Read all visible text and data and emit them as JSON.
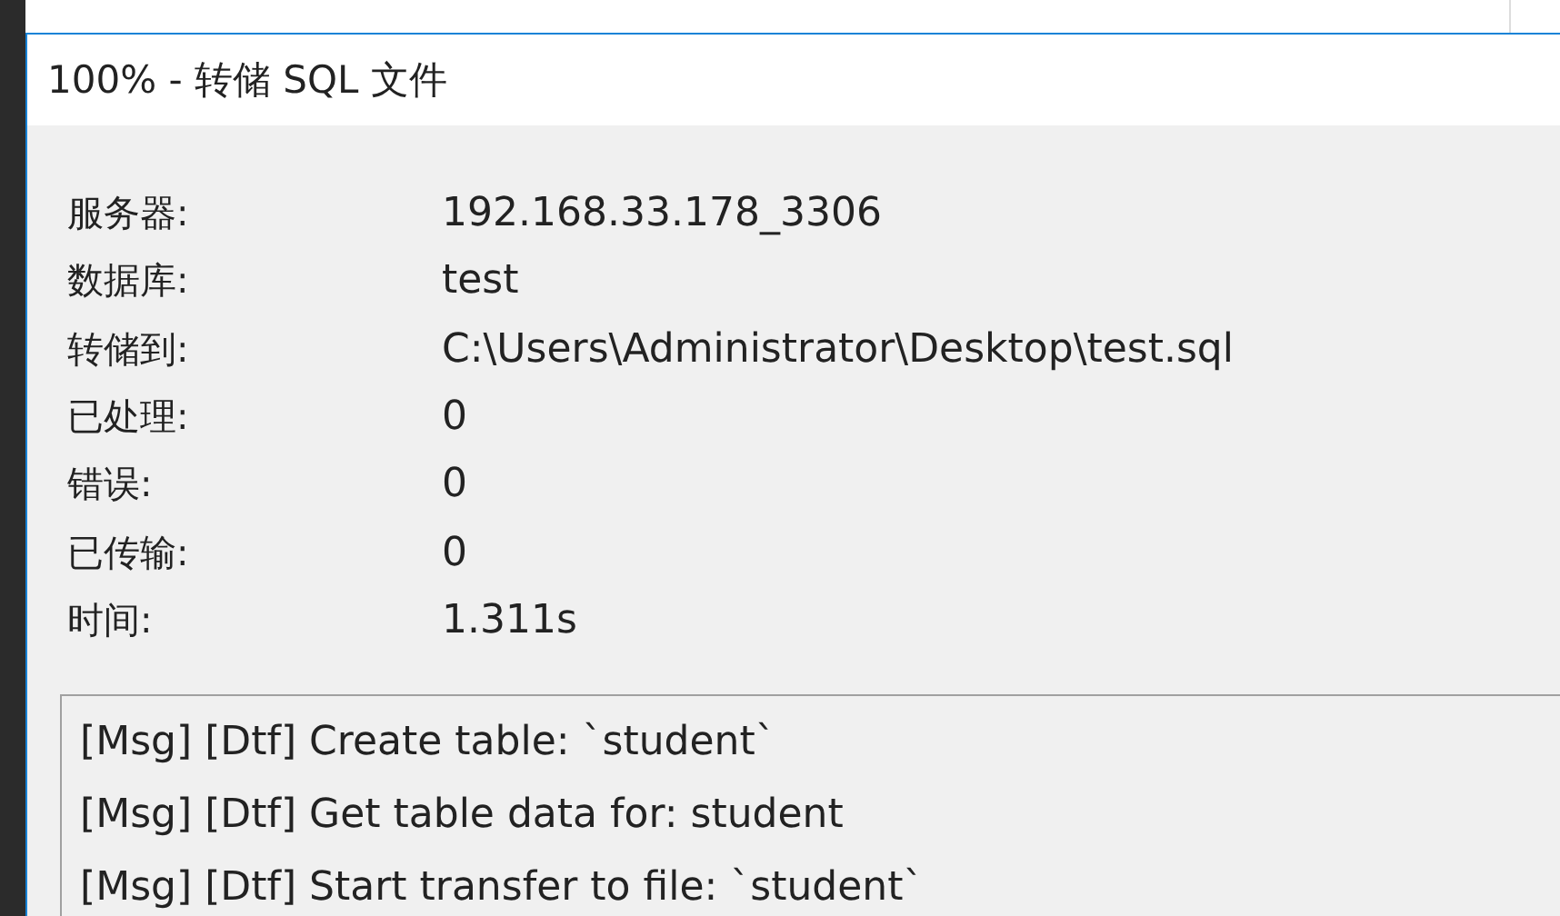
{
  "dialog": {
    "title": "100% - 转储 SQL 文件",
    "info": [
      {
        "label": "服务器:",
        "value": "192.168.33.178_3306"
      },
      {
        "label": "数据库:",
        "value": "test"
      },
      {
        "label": "转储到:",
        "value": "C:\\Users\\Administrator\\Desktop\\test.sql"
      },
      {
        "label": "已处理:",
        "value": "0"
      },
      {
        "label": "错误:",
        "value": "0"
      },
      {
        "label": "已传输:",
        "value": "0"
      },
      {
        "label": "时间:",
        "value": "1.311s"
      }
    ],
    "log": [
      "[Msg] [Dtf] Create table: `student`",
      "[Msg] [Dtf] Get table data for: student",
      "[Msg] [Dtf] Start transfer to file: `student`"
    ]
  }
}
